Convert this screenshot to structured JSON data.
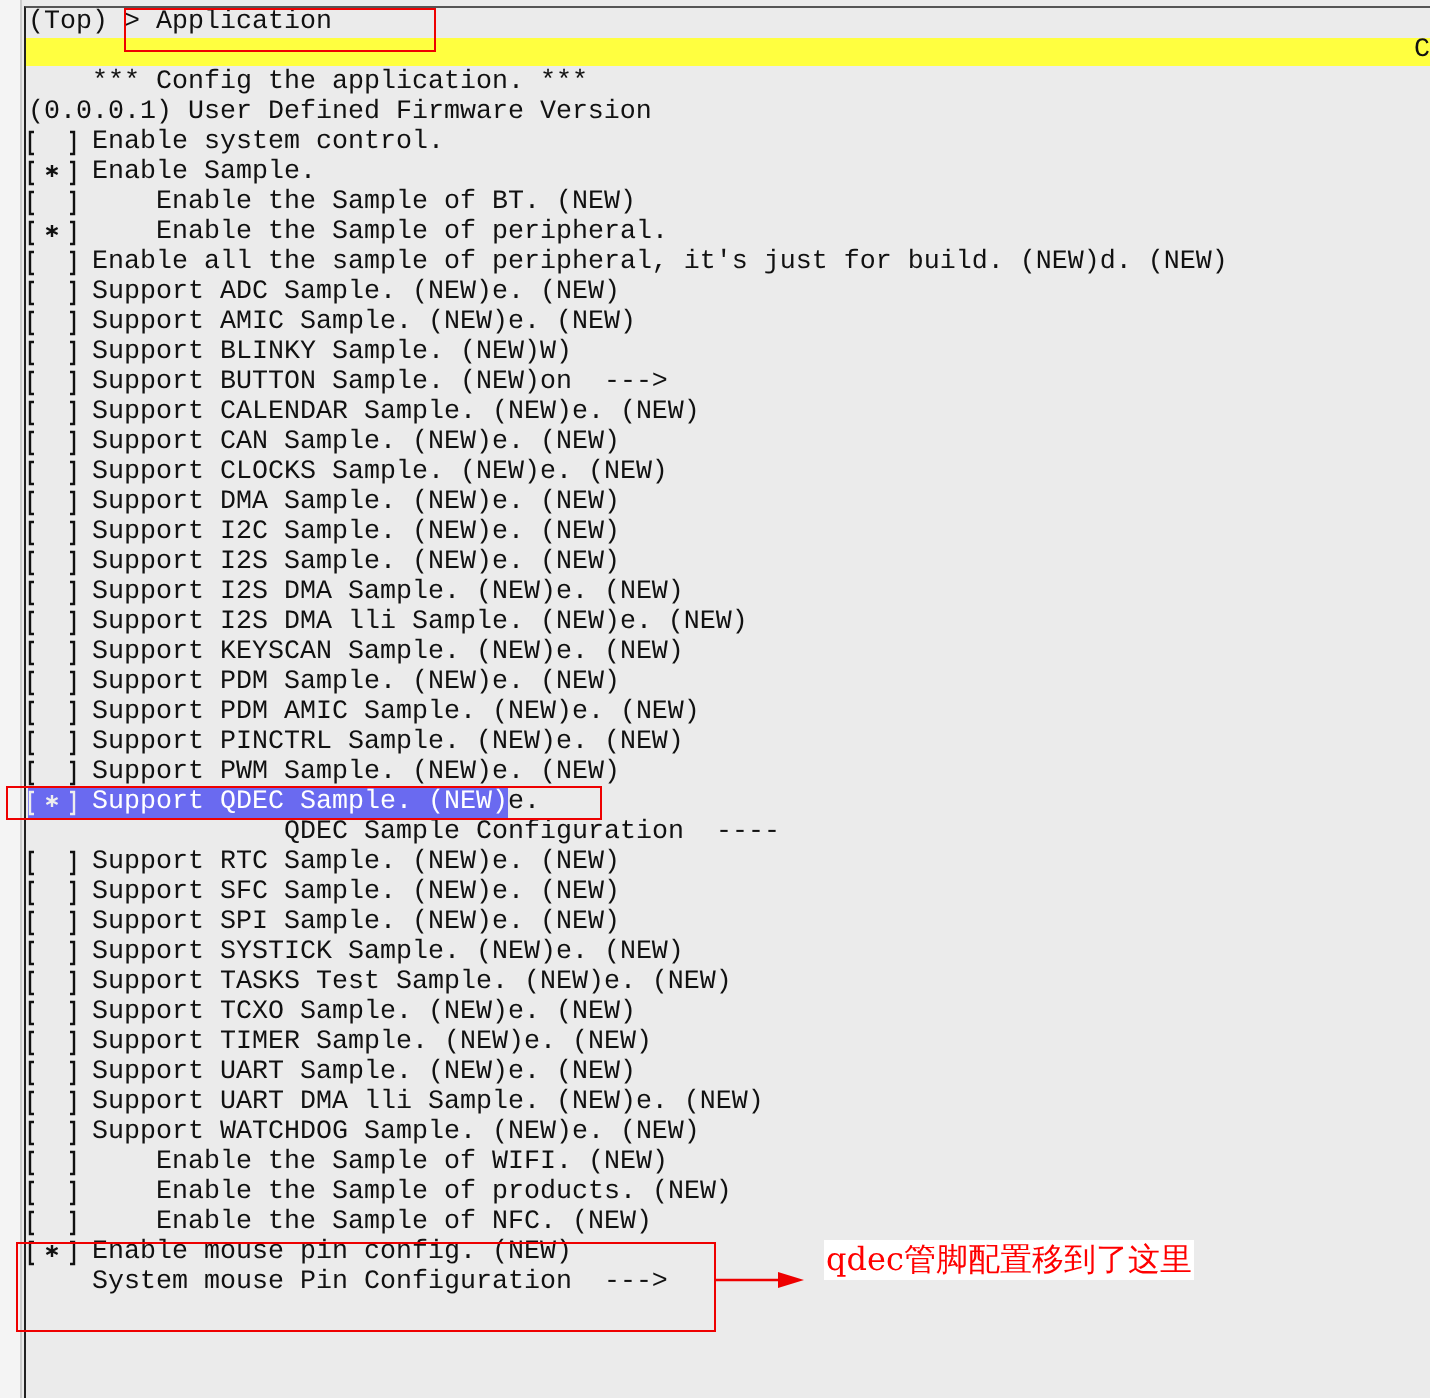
{
  "breadcrumb": "(Top) > Application",
  "title_bar": {
    "edge_text": "C"
  },
  "rows": [
    {
      "kind": "comment",
      "label": "*** Config the application. ***"
    },
    {
      "kind": "string",
      "label": "(0.0.0.1) User Defined Firmware Version"
    },
    {
      "kind": "checkbox",
      "checked": false,
      "selected": false,
      "label": "Enable system control."
    },
    {
      "kind": "checkbox",
      "checked": true,
      "selected": false,
      "label": "Enable Sample."
    },
    {
      "kind": "sub_checkbox",
      "checked": false,
      "selected": false,
      "label": "Enable the Sample of BT. (NEW)"
    },
    {
      "kind": "sub_checkbox",
      "checked": true,
      "selected": false,
      "label": "Enable the Sample of peripheral."
    },
    {
      "kind": "checkbox",
      "checked": false,
      "selected": false,
      "label": "Enable all the sample of peripheral, it's just for build. (NEW)d. (NEW)"
    },
    {
      "kind": "checkbox",
      "checked": false,
      "selected": false,
      "label": "Support ADC Sample. (NEW)e. (NEW)"
    },
    {
      "kind": "checkbox",
      "checked": false,
      "selected": false,
      "label": "Support AMIC Sample. (NEW)e. (NEW)"
    },
    {
      "kind": "checkbox",
      "checked": false,
      "selected": false,
      "label": "Support BLINKY Sample. (NEW)W)"
    },
    {
      "kind": "checkbox",
      "checked": false,
      "selected": false,
      "label": "Support BUTTON Sample. (NEW)on  --->"
    },
    {
      "kind": "checkbox",
      "checked": false,
      "selected": false,
      "label": "Support CALENDAR Sample. (NEW)e. (NEW)"
    },
    {
      "kind": "checkbox",
      "checked": false,
      "selected": false,
      "label": "Support CAN Sample. (NEW)e. (NEW)"
    },
    {
      "kind": "checkbox",
      "checked": false,
      "selected": false,
      "label": "Support CLOCKS Sample. (NEW)e. (NEW)"
    },
    {
      "kind": "checkbox",
      "checked": false,
      "selected": false,
      "label": "Support DMA Sample. (NEW)e. (NEW)"
    },
    {
      "kind": "checkbox",
      "checked": false,
      "selected": false,
      "label": "Support I2C Sample. (NEW)e. (NEW)"
    },
    {
      "kind": "checkbox",
      "checked": false,
      "selected": false,
      "label": "Support I2S Sample. (NEW)e. (NEW)"
    },
    {
      "kind": "checkbox",
      "checked": false,
      "selected": false,
      "label": "Support I2S DMA Sample. (NEW)e. (NEW)"
    },
    {
      "kind": "checkbox",
      "checked": false,
      "selected": false,
      "label": "Support I2S DMA lli Sample. (NEW)e. (NEW)"
    },
    {
      "kind": "checkbox",
      "checked": false,
      "selected": false,
      "label": "Support KEYSCAN Sample. (NEW)e. (NEW)"
    },
    {
      "kind": "checkbox",
      "checked": false,
      "selected": false,
      "label": "Support PDM Sample. (NEW)e. (NEW)"
    },
    {
      "kind": "checkbox",
      "checked": false,
      "selected": false,
      "label": "Support PDM AMIC Sample. (NEW)e. (NEW)"
    },
    {
      "kind": "checkbox",
      "checked": false,
      "selected": false,
      "label": "Support PINCTRL Sample. (NEW)e. (NEW)"
    },
    {
      "kind": "checkbox",
      "checked": false,
      "selected": false,
      "label": "Support PWM Sample. (NEW)e. (NEW)"
    },
    {
      "kind": "checkbox",
      "checked": true,
      "selected": true,
      "label": "Support QDEC Sample. (NEW)",
      "trailing": "e."
    },
    {
      "kind": "section",
      "label": "QDEC Sample Configuration  ----"
    },
    {
      "kind": "checkbox",
      "checked": false,
      "selected": false,
      "label": "Support RTC Sample. (NEW)e. (NEW)"
    },
    {
      "kind": "checkbox",
      "checked": false,
      "selected": false,
      "label": "Support SFC Sample. (NEW)e. (NEW)"
    },
    {
      "kind": "checkbox",
      "checked": false,
      "selected": false,
      "label": "Support SPI Sample. (NEW)e. (NEW)"
    },
    {
      "kind": "checkbox",
      "checked": false,
      "selected": false,
      "label": "Support SYSTICK Sample. (NEW)e. (NEW)"
    },
    {
      "kind": "checkbox",
      "checked": false,
      "selected": false,
      "label": "Support TASKS Test Sample. (NEW)e. (NEW)"
    },
    {
      "kind": "checkbox",
      "checked": false,
      "selected": false,
      "label": "Support TCXO Sample. (NEW)e. (NEW)"
    },
    {
      "kind": "checkbox",
      "checked": false,
      "selected": false,
      "label": "Support TIMER Sample. (NEW)e. (NEW)"
    },
    {
      "kind": "checkbox",
      "checked": false,
      "selected": false,
      "label": "Support UART Sample. (NEW)e. (NEW)"
    },
    {
      "kind": "checkbox",
      "checked": false,
      "selected": false,
      "label": "Support UART DMA lli Sample. (NEW)e. (NEW)"
    },
    {
      "kind": "checkbox",
      "checked": false,
      "selected": false,
      "label": "Support WATCHDOG Sample. (NEW)e. (NEW)"
    },
    {
      "kind": "sub_checkbox",
      "checked": false,
      "selected": false,
      "label": "Enable the Sample of WIFI. (NEW)"
    },
    {
      "kind": "sub_checkbox",
      "checked": false,
      "selected": false,
      "label": "Enable the Sample of products. (NEW)"
    },
    {
      "kind": "sub_checkbox",
      "checked": false,
      "selected": false,
      "label": "Enable the Sample of NFC. (NEW)"
    },
    {
      "kind": "checkbox",
      "checked": true,
      "selected": false,
      "label": "Enable mouse pin config. (NEW)"
    },
    {
      "kind": "menu",
      "label": "System mouse Pin Configuration  --->"
    }
  ],
  "annotation": {
    "note": "qdec管脚配置移到了这里"
  }
}
